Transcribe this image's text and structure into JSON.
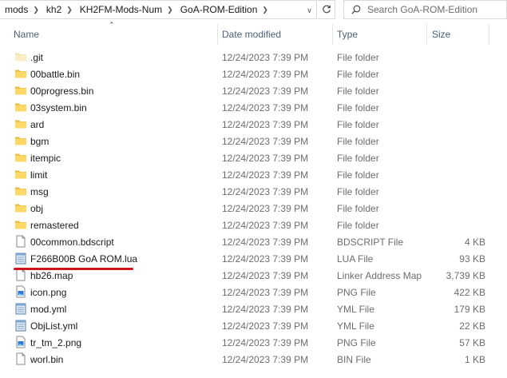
{
  "breadcrumb": [
    "mods",
    "kh2",
    "KH2FM-Mods-Num",
    "GoA-ROM-Edition"
  ],
  "search": {
    "placeholder": "Search GoA-ROM-Edition"
  },
  "columns": {
    "name": "Name",
    "date": "Date modified",
    "type": "Type",
    "size": "Size"
  },
  "colors": {
    "folder": "#ffd866",
    "underline": "#d0141c",
    "header_text": "#4c607a"
  },
  "files": [
    {
      "name": ".git",
      "date": "12/24/2023 7:39 PM",
      "type": "File folder",
      "size": "",
      "icon": "folder-hidden-icon"
    },
    {
      "name": "00battle.bin",
      "date": "12/24/2023 7:39 PM",
      "type": "File folder",
      "size": "",
      "icon": "folder-icon"
    },
    {
      "name": "00progress.bin",
      "date": "12/24/2023 7:39 PM",
      "type": "File folder",
      "size": "",
      "icon": "folder-icon"
    },
    {
      "name": "03system.bin",
      "date": "12/24/2023 7:39 PM",
      "type": "File folder",
      "size": "",
      "icon": "folder-icon"
    },
    {
      "name": "ard",
      "date": "12/24/2023 7:39 PM",
      "type": "File folder",
      "size": "",
      "icon": "folder-icon"
    },
    {
      "name": "bgm",
      "date": "12/24/2023 7:39 PM",
      "type": "File folder",
      "size": "",
      "icon": "folder-icon"
    },
    {
      "name": "itempic",
      "date": "12/24/2023 7:39 PM",
      "type": "File folder",
      "size": "",
      "icon": "folder-icon"
    },
    {
      "name": "limit",
      "date": "12/24/2023 7:39 PM",
      "type": "File folder",
      "size": "",
      "icon": "folder-icon"
    },
    {
      "name": "msg",
      "date": "12/24/2023 7:39 PM",
      "type": "File folder",
      "size": "",
      "icon": "folder-icon"
    },
    {
      "name": "obj",
      "date": "12/24/2023 7:39 PM",
      "type": "File folder",
      "size": "",
      "icon": "folder-icon"
    },
    {
      "name": "remastered",
      "date": "12/24/2023 7:39 PM",
      "type": "File folder",
      "size": "",
      "icon": "folder-icon"
    },
    {
      "name": "00common.bdscript",
      "date": "12/24/2023 7:39 PM",
      "type": "BDSCRIPT File",
      "size": "4 KB",
      "icon": "blank-file-icon"
    },
    {
      "name": "F266B00B GoA ROM.lua",
      "date": "12/24/2023 7:39 PM",
      "type": "LUA File",
      "size": "93 KB",
      "icon": "notepad-file-icon"
    },
    {
      "name": "hb26.map",
      "date": "12/24/2023 7:39 PM",
      "type": "Linker Address Map",
      "size": "3,739 KB",
      "icon": "blank-file-icon"
    },
    {
      "name": "icon.png",
      "date": "12/24/2023 7:39 PM",
      "type": "PNG File",
      "size": "422 KB",
      "icon": "image-file-icon"
    },
    {
      "name": "mod.yml",
      "date": "12/24/2023 7:39 PM",
      "type": "YML File",
      "size": "179 KB",
      "icon": "notepad-file-icon"
    },
    {
      "name": "ObjList.yml",
      "date": "12/24/2023 7:39 PM",
      "type": "YML File",
      "size": "22 KB",
      "icon": "notepad-file-icon"
    },
    {
      "name": "tr_tm_2.png",
      "date": "12/24/2023 7:39 PM",
      "type": "PNG File",
      "size": "57 KB",
      "icon": "image-file-icon"
    },
    {
      "name": "worl.bin",
      "date": "12/24/2023 7:39 PM",
      "type": "BIN File",
      "size": "1 KB",
      "icon": "blank-file-icon"
    }
  ]
}
